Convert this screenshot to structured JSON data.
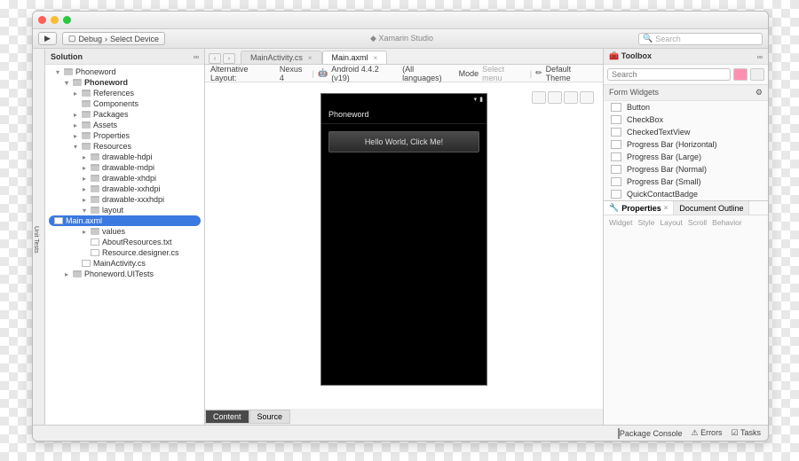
{
  "toolbar": {
    "debug": "Debug",
    "device": "Select Device",
    "ide": "Xamarin Studio",
    "search_ph": "Search"
  },
  "left_rail": "Unit Tests",
  "solution": {
    "title": "Solution",
    "root": "Phoneword",
    "proj": "Phoneword",
    "refs": "References",
    "comp": "Components",
    "pkgs": "Packages",
    "assets": "Assets",
    "props": "Properties",
    "res": "Resources",
    "dh": "drawable-hdpi",
    "dm": "drawable-mdpi",
    "dxh": "drawable-xhdpi",
    "dxxh": "drawable-xxhdpi",
    "dxxxh": "drawable-xxxhdpi",
    "layout": "layout",
    "main": "Main.axml",
    "values": "values",
    "about": "AboutResources.txt",
    "resdes": "Resource.designer.cs",
    "mainact": "MainActivity.cs",
    "uitests": "Phoneword.UITests"
  },
  "tabs": {
    "a": "MainActivity.cs",
    "b": "Main.axml"
  },
  "ctx": {
    "alt": "Alternative Layout:",
    "device": "Nexus 4",
    "api": "Android 4.4.2 (v19)",
    "lang": "(All languages)",
    "mode": "Mode",
    "selmenu": "Select menu",
    "theme": "Default Theme"
  },
  "phone": {
    "appname": "Phoneword",
    "btn": "Hello World, Click Me!"
  },
  "btabs": {
    "content": "Content",
    "source": "Source"
  },
  "toolbox": {
    "title": "Toolbox",
    "group": "Form Widgets",
    "items": [
      "Button",
      "CheckBox",
      "CheckedTextView",
      "Progress Bar (Horizontal)",
      "Progress Bar (Large)",
      "Progress Bar (Normal)",
      "Progress Bar (Small)",
      "QuickContactBadge"
    ]
  },
  "props": {
    "tab1": "Properties",
    "tab2": "Document Outline",
    "subs": [
      "Widget",
      "Style",
      "Layout",
      "Scroll",
      "Behavior"
    ]
  },
  "status": {
    "pkg": "Package Console",
    "err": "Errors",
    "tasks": "Tasks"
  }
}
